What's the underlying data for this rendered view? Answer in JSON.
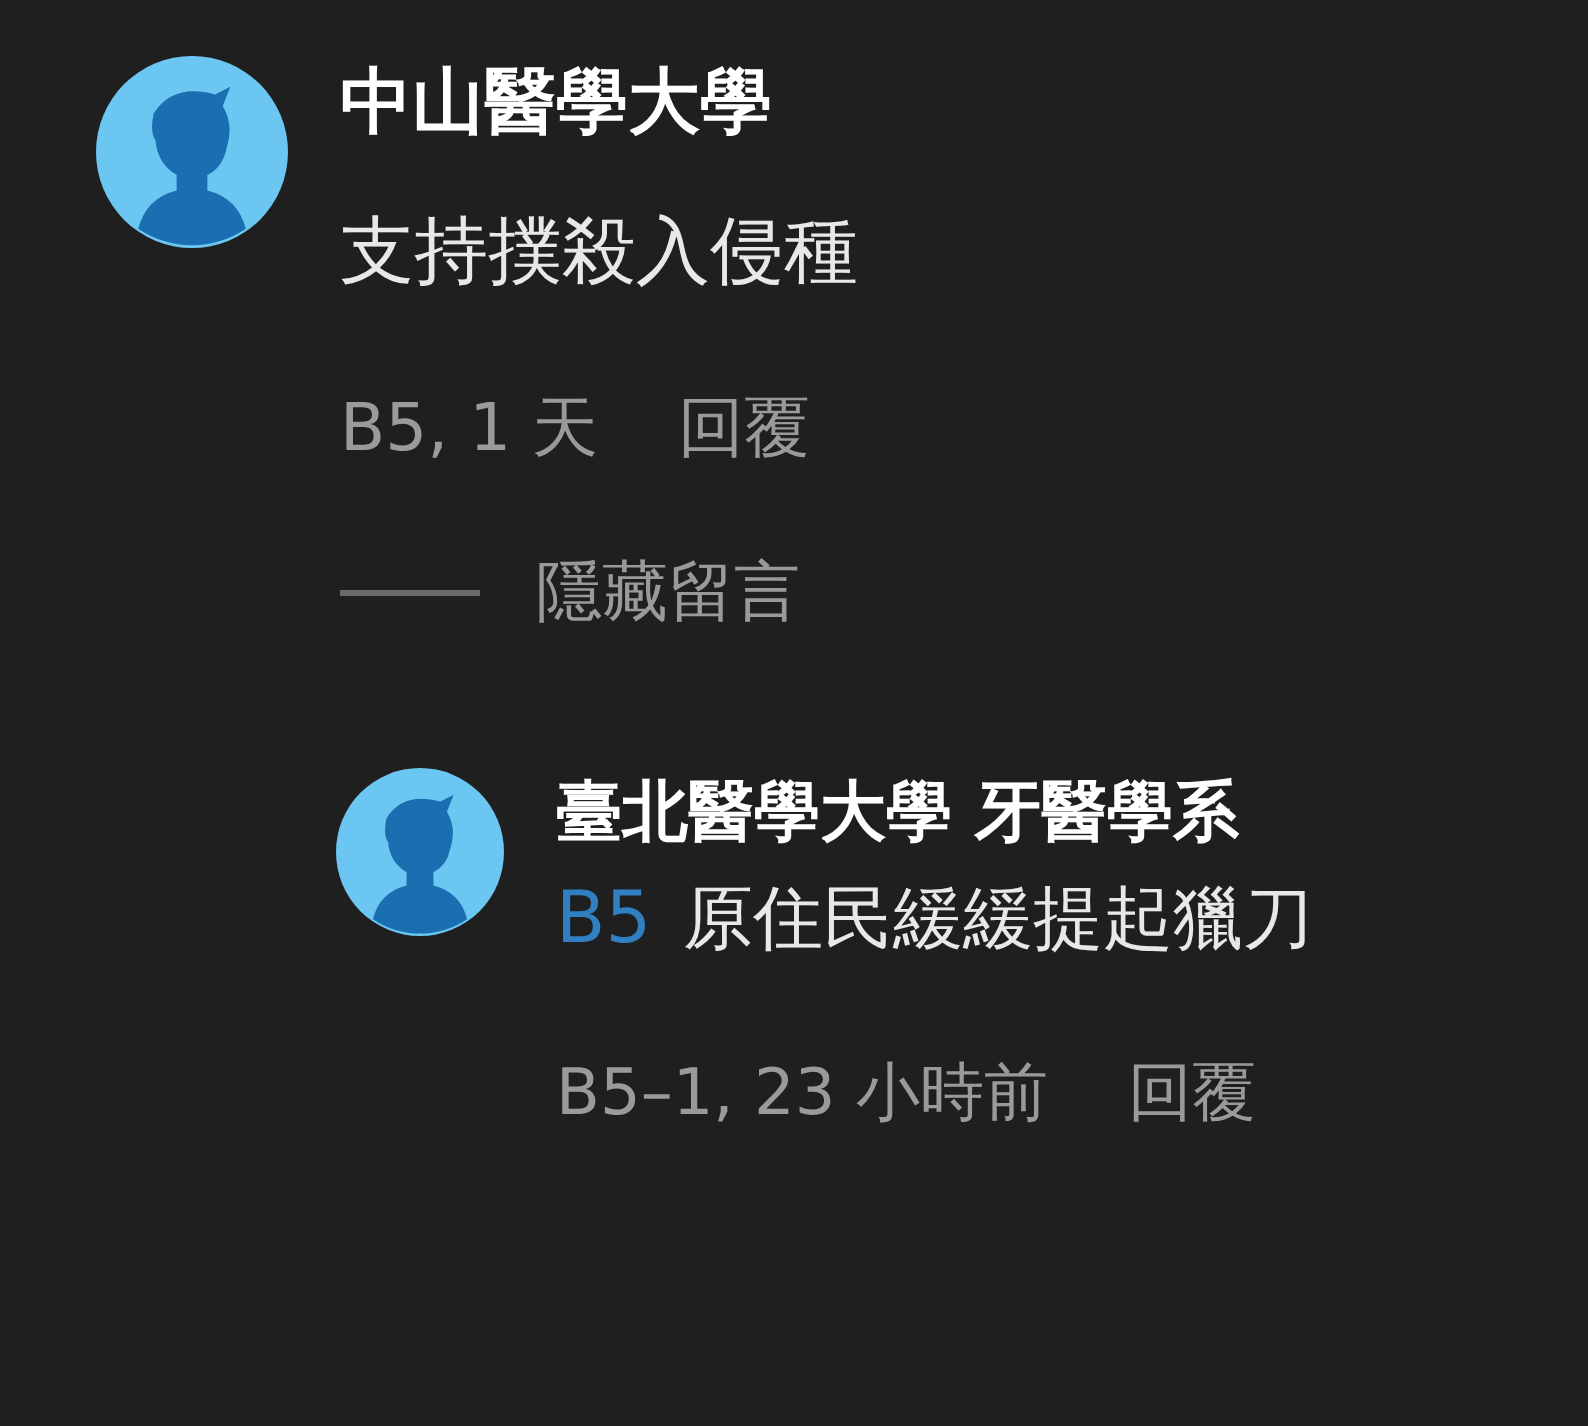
{
  "comments": [
    {
      "author": "中山醫學大學",
      "text": "支持撲殺入侵種",
      "meta": "B5, 1 天",
      "reply_label": "回覆",
      "hide_label": "隱藏留言",
      "replies": [
        {
          "author": "臺北醫學大學 牙醫學系",
          "mention": "B5",
          "text": "原住民緩緩提起獵刀",
          "meta": "B5–1, 23 小時前",
          "reply_label": "回覆"
        }
      ]
    }
  ]
}
